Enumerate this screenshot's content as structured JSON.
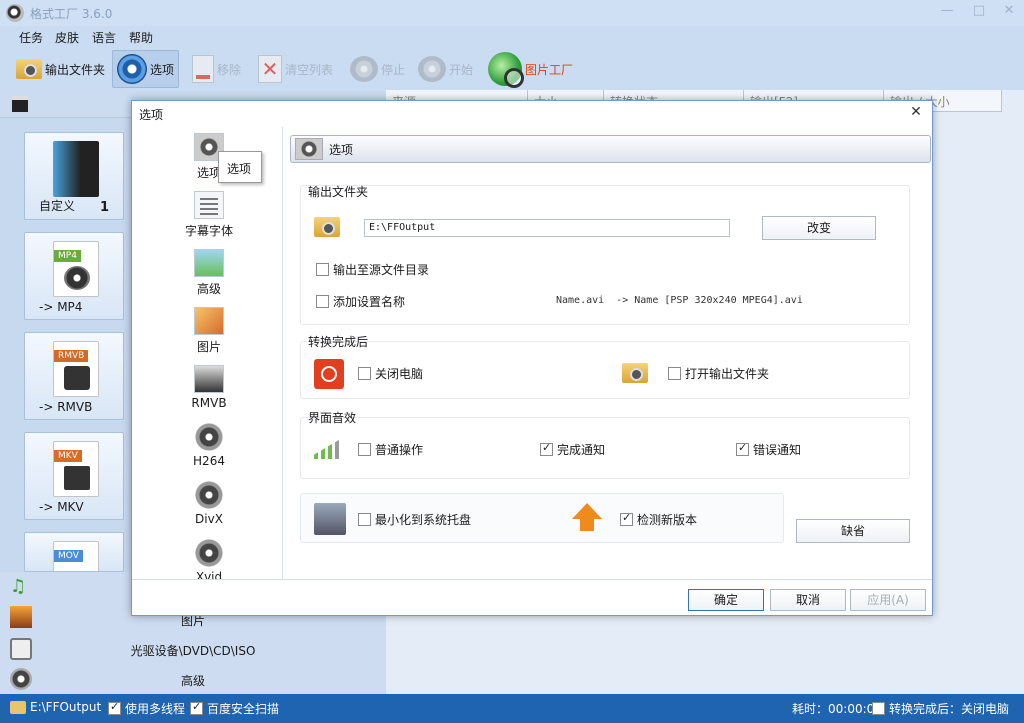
{
  "window": {
    "title": "格式工厂 3.6.0",
    "min": "—",
    "max": "□",
    "close": "✕"
  },
  "menu": [
    "任务",
    "皮肤",
    "语言",
    "帮助"
  ],
  "toolbar": {
    "output_folder": "输出文件夹",
    "options": "选项",
    "remove": "移除",
    "clear_list": "清空列表",
    "stop": "停止",
    "start": "开始",
    "picture_factory": "图片工厂"
  },
  "task_columns": [
    "来源",
    "大小",
    "转换状态",
    "输出[F2]",
    "输出 / 大小"
  ],
  "categories": [
    {
      "label": "自定义",
      "count": "1"
    },
    {
      "label": "-> MP4",
      "tag": "MP4"
    },
    {
      "label": "-> RMVB",
      "tag": "RMVB"
    },
    {
      "label": "-> MKV",
      "tag": "MKV"
    },
    {
      "tag": "MOV"
    }
  ],
  "lower_nav": [
    "图片",
    "光驱设备\\DVD\\CD\\ISO",
    "高级"
  ],
  "status": {
    "output_path": "E:\\FFOutput",
    "multithread": "使用多线程",
    "baidu_scan": "百度安全扫描",
    "elapsed": "耗时：00:00:00",
    "after_convert": "转换完成后：关闭电脑"
  },
  "dialog": {
    "title": "选项",
    "close": "✕",
    "tooltip": "选项",
    "nav": [
      "选项",
      "字幕字体",
      "高级",
      "图片",
      "RMVB",
      "H264",
      "DivX",
      "Xvid"
    ],
    "section_title": "选项",
    "output_folder": {
      "label": "输出文件夹",
      "path": "E:\\FFOutput",
      "change_button": "改变",
      "output_to_source": "输出至源文件目录",
      "add_setting_name": "添加设置名称",
      "name_example": "Name.avi  -> Name [PSP 320x240 MPEG4].avi"
    },
    "after_convert": {
      "label": "转换完成后",
      "shutdown": "关闭电脑",
      "open_output_folder": "打开输出文件夹"
    },
    "sounds": {
      "label": "界面音效",
      "normal": "普通操作",
      "done": "完成通知",
      "error": "错误通知"
    },
    "misc": {
      "minimize_to_tray": "最小化到系统托盘",
      "check_update": "检测新版本",
      "default_button": "缺省"
    },
    "footer": {
      "ok": "确定",
      "cancel": "取消",
      "apply": "应用(A)"
    }
  },
  "colors": {
    "statusbar": "#1f64b0",
    "background": "#c9dcf1",
    "accent": "#3b6fb3"
  }
}
